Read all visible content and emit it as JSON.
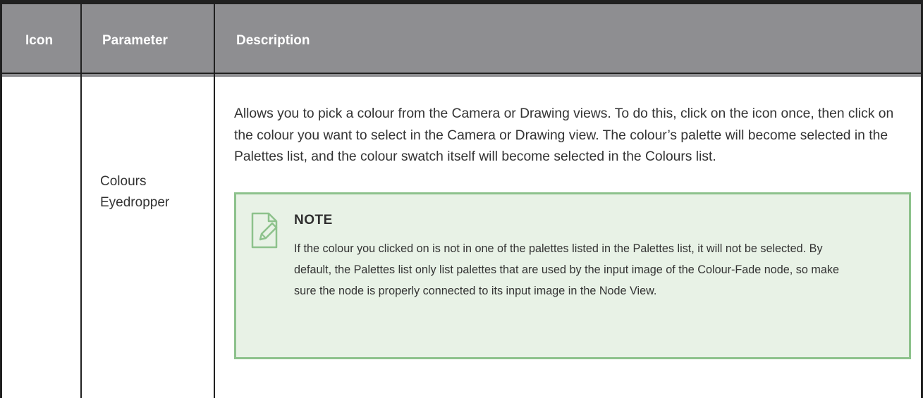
{
  "table": {
    "headers": {
      "icon": "Icon",
      "parameter": "Parameter",
      "description": "Description"
    },
    "rows": [
      {
        "icon": "",
        "parameter": "Colours Eyedropper",
        "description": "Allows you to pick a colour from the Camera or Drawing views. To do this, click on the icon once, then click on the colour you want to select in the Camera or Drawing view. The colour’s palette will become selected in the Palettes list, and the colour swatch itself will become selected in the Colours list.",
        "note": {
          "icon": "note-pencil-icon",
          "title": "NOTE",
          "text": "If the colour you clicked on is not in one of the palettes listed in the Palettes list, it will not be selected. By default, the Palettes list only list palettes that are used by the input image of the Colour-Fade node, so make sure the node is properly connected to its input image in the Node View."
        }
      }
    ]
  },
  "colors": {
    "header_bg": "#8e8e91",
    "header_text": "#ffffff",
    "border": "#202020",
    "note_bg": "#e8f2e6",
    "note_border": "#8dc28c"
  }
}
